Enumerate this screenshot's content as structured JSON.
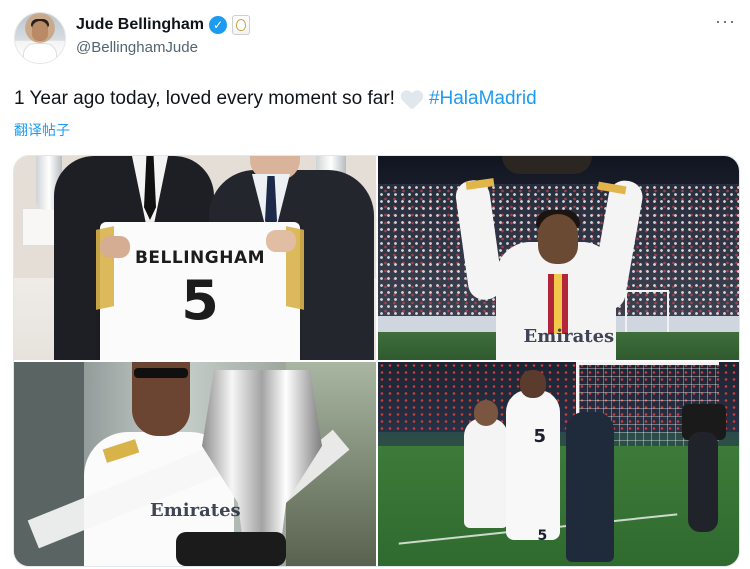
{
  "author": {
    "display_name": "Jude Bellingham",
    "handle": "@BellinghamJude",
    "verified": true,
    "affiliation_badge": "real-madrid-crest",
    "avatar_icon": "profile-avatar"
  },
  "menu": {
    "more_label": "···"
  },
  "tweet": {
    "text": "1 Year ago today, loved every moment so far!",
    "emoji": "white-heart",
    "hashtag": "#HalaMadrid",
    "translate_label": "翻译帖子"
  },
  "media": {
    "photo_count": 4,
    "photo1": {
      "jersey_name": "BELLINGHAM",
      "jersey_number": "5"
    },
    "photo2": {
      "shirt_text": "Emirates"
    },
    "photo3": {
      "shirt_text": "Emirates"
    },
    "photo4": {
      "shirt_number_back": "5",
      "shirt_number_front": "5"
    }
  },
  "colors": {
    "link": "#1d9bf0",
    "secondary_text": "#536471",
    "primary_text": "#0f1419",
    "verified_badge": "#1d9bf0",
    "heart": "#e1e8ed"
  }
}
